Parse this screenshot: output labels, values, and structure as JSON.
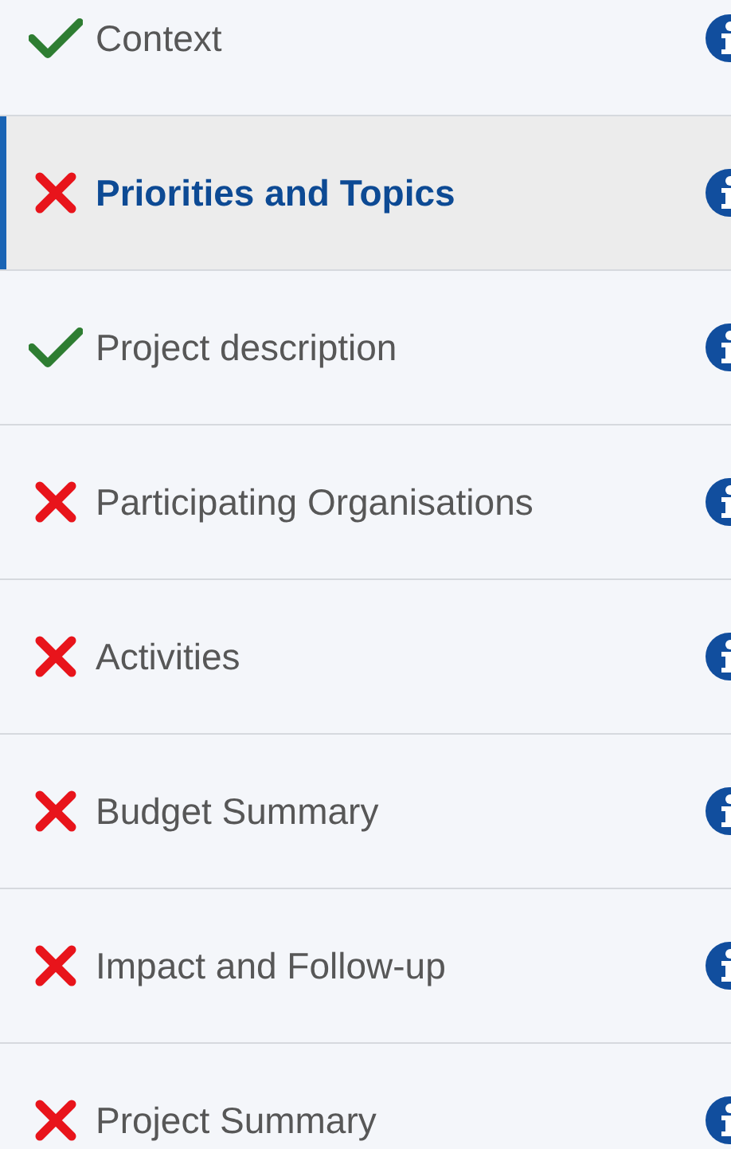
{
  "steps": [
    {
      "label": "Context",
      "kind": "done",
      "selected": false
    },
    {
      "label": "Priorities and Topics",
      "kind": "error",
      "selected": true
    },
    {
      "label": "Project description",
      "kind": "done",
      "selected": false
    },
    {
      "label": "Participating Organisations",
      "kind": "error",
      "selected": false
    },
    {
      "label": "Activities",
      "kind": "error",
      "selected": false
    },
    {
      "label": "Budget Summary",
      "kind": "error",
      "selected": false
    },
    {
      "label": "Impact and Follow-up",
      "kind": "error",
      "selected": false
    },
    {
      "label": "Project Summary",
      "kind": "error",
      "selected": false
    }
  ]
}
